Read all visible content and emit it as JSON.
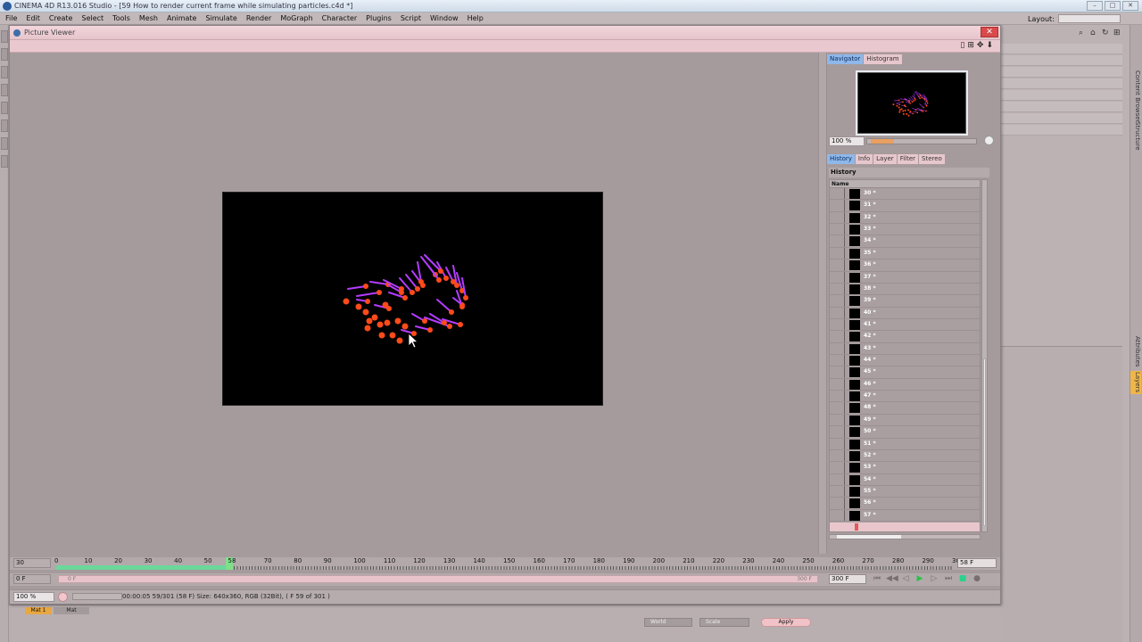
{
  "app": {
    "title": "CINEMA 4D R13.016 Studio - [59 How to render current frame while simulating particles.c4d *]",
    "menu": [
      "File",
      "Edit",
      "Create",
      "Select",
      "Tools",
      "Mesh",
      "Animate",
      "Simulate",
      "Render",
      "MoGraph",
      "Character",
      "Plugins",
      "Script",
      "Window",
      "Help"
    ],
    "layout_label": "Layout:",
    "right_tabs": [
      "Content Browser",
      "Structure",
      "Attributes",
      "Layers"
    ],
    "bottom": {
      "material_tab": "Mat 1",
      "material_tab2": "Mat",
      "coord_world": "World",
      "coord_scale": "Scale",
      "apply_label": "Apply"
    }
  },
  "picture_viewer": {
    "title": "Picture Viewer",
    "navigator": {
      "tabs": [
        "Navigator",
        "Histogram"
      ],
      "zoom": "100 %",
      "zoom_fraction": 0.22
    },
    "history": {
      "tabs": [
        "History",
        "Info",
        "Layer",
        "Filter",
        "Stereo"
      ],
      "header": "History",
      "column": "Name",
      "entries": [
        "30 *",
        "31 *",
        "32 *",
        "33 *",
        "34 *",
        "35 *",
        "36 *",
        "37 *",
        "38 *",
        "39 *",
        "40 *",
        "41 *",
        "42 *",
        "43 *",
        "44 *",
        "45 *",
        "46 *",
        "47 *",
        "48 *",
        "49 *",
        "50 *",
        "51 *",
        "52 *",
        "53 *",
        "54 *",
        "55 *",
        "56 *",
        "57 *"
      ]
    },
    "timeline": {
      "start_field": "30",
      "ticks": [
        "0",
        "10",
        "20",
        "30",
        "40",
        "50",
        "58",
        "70",
        "80",
        "90",
        "100",
        "110",
        "120",
        "130",
        "140",
        "150",
        "160",
        "170",
        "180",
        "190",
        "200",
        "210",
        "220",
        "230",
        "240",
        "250",
        "260",
        "270",
        "280",
        "290",
        "300"
      ],
      "current_frame": 58,
      "max_frame": 300,
      "end_field": "58 F"
    },
    "range": {
      "start_field": "0 F",
      "slider_left": "0 F",
      "slider_right": "300 F",
      "end_field": "300 F",
      "transport": [
        "⏮",
        "◀◀",
        "◁",
        "▶",
        "▷",
        "⏭",
        "■",
        "●"
      ]
    },
    "status": {
      "zoom": "100 %",
      "info": "00:00:05 59/301 (58 F)   Size: 640x360, RGB (32Bit), ( F 59 of 301 )"
    }
  },
  "colors": {
    "particle_orange": "#ff4a1a",
    "particle_purple": "#b43cff",
    "accent_green": "#6bd79a",
    "tab_blue": "#8fb8ea"
  }
}
